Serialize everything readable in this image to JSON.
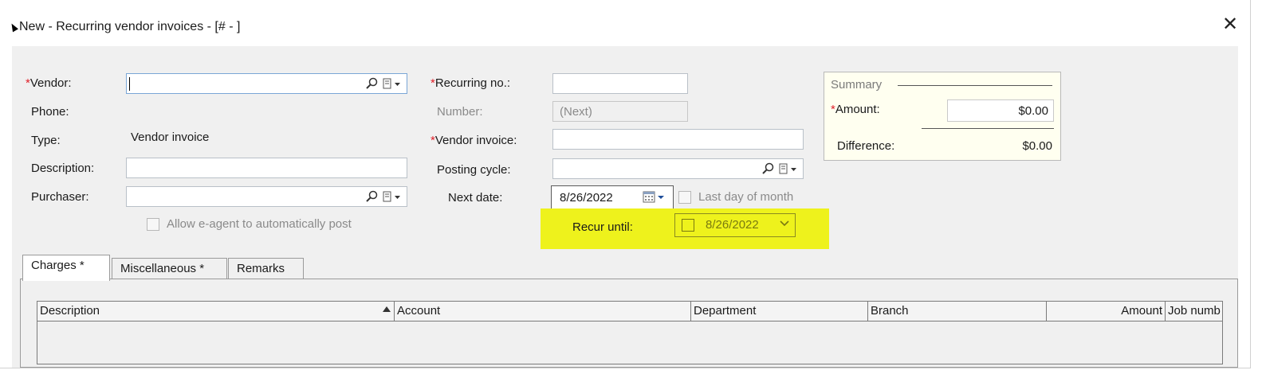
{
  "window": {
    "title": "New - Recurring vendor invoices - [# - ]",
    "close_label": "✕"
  },
  "form": {
    "required_mark": "*",
    "vendor_label": "Vendor:",
    "vendor_value": "",
    "phone_label": "Phone:",
    "type_label": "Type:",
    "type_value": "Vendor invoice",
    "description_label": "Description:",
    "description_value": "",
    "purchaser_label": "Purchaser:",
    "purchaser_value": "",
    "allow_eagent_label": "Allow e-agent to automatically post",
    "recurring_no_label": "Recurring no.:",
    "recurring_no_value": "",
    "number_label": "Number:",
    "number_value": "(Next)",
    "vendor_invoice_label": "Vendor invoice:",
    "vendor_invoice_value": "",
    "posting_cycle_label": "Posting cycle:",
    "posting_cycle_value": "",
    "next_date_label": "Next date:",
    "next_date_value": "8/26/2022",
    "last_day_label": "Last day of month",
    "recur_until_label": "Recur until:",
    "recur_until_value": "8/26/2022"
  },
  "summary": {
    "legend": "Summary",
    "amount_label": "Amount:",
    "amount_value": "$0.00",
    "difference_label": "Difference:",
    "difference_value": "$0.00"
  },
  "tabs": [
    {
      "label": "Charges  *"
    },
    {
      "label": "Miscellaneous *"
    },
    {
      "label": "Remarks"
    }
  ],
  "grid": {
    "columns": [
      "Description",
      "Account",
      "Department",
      "Branch",
      "Amount",
      "Job numb"
    ]
  },
  "colors": {
    "highlight": "#eef21c",
    "required": "#e0202a",
    "summary_bg": "#fffff0"
  }
}
